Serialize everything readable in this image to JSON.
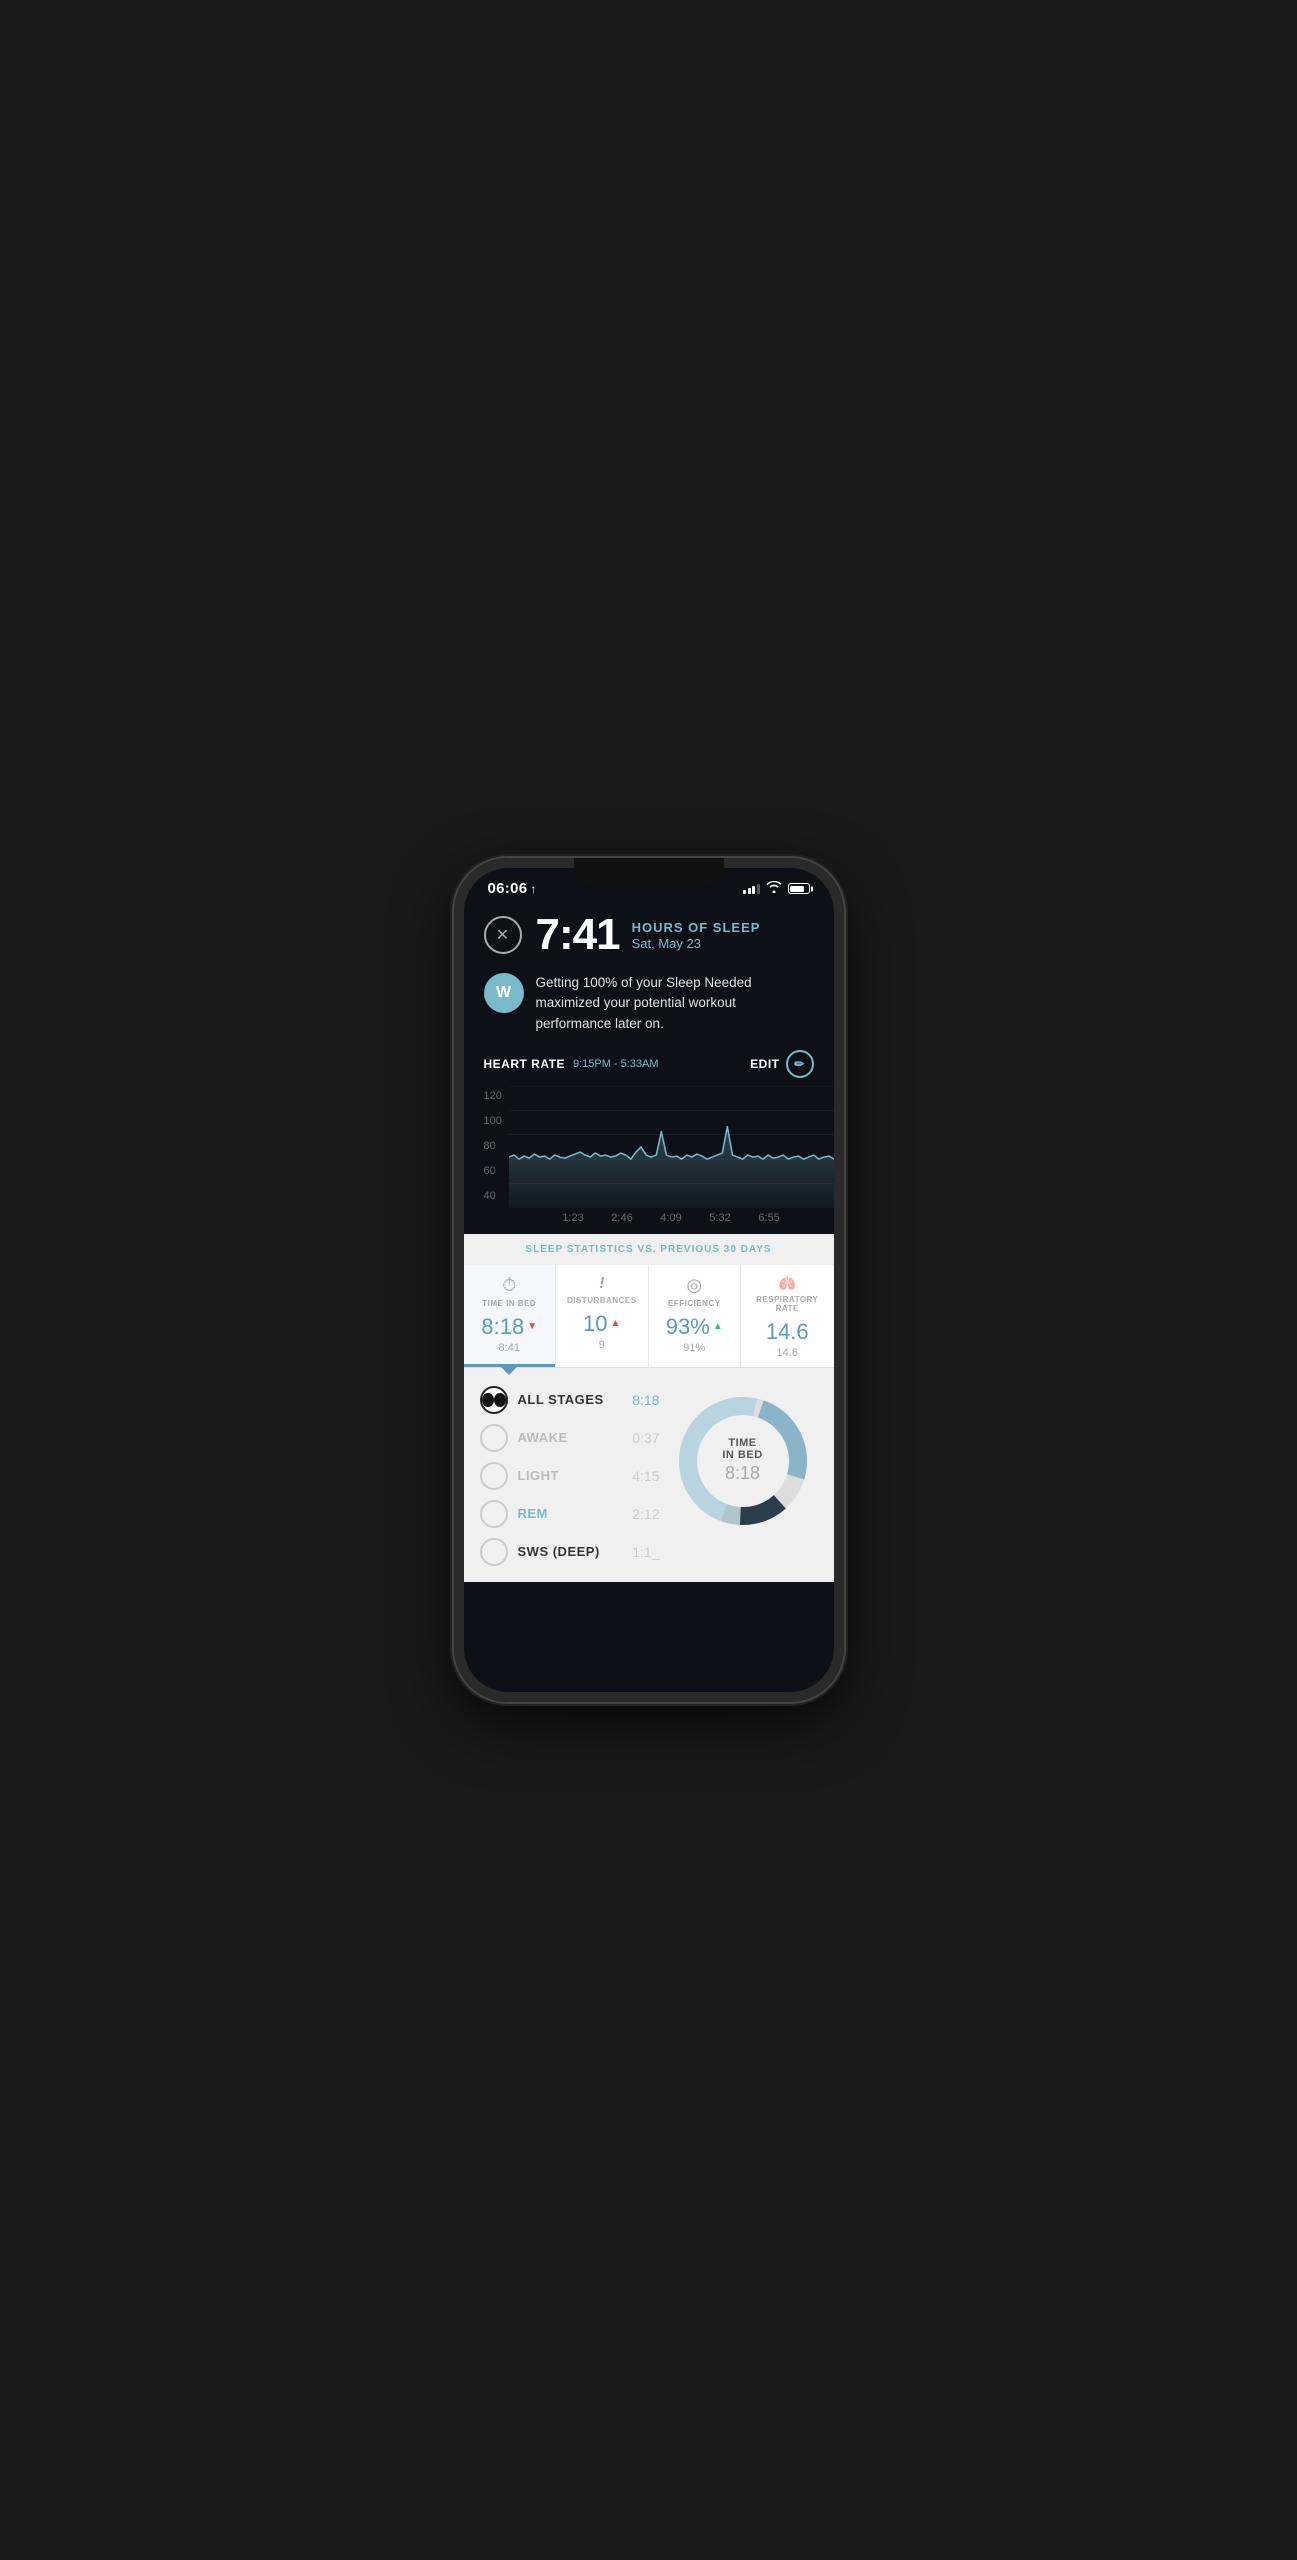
{
  "status": {
    "time": "06:06",
    "location_arrow": "↑"
  },
  "header": {
    "sleep_time": "7:41",
    "label": "HOURS OF SLEEP",
    "date": "Sat, May 23"
  },
  "insight": {
    "avatar_initials": "W",
    "text": "Getting 100% of your Sleep Needed maximized your potential workout performance later on."
  },
  "heart_rate": {
    "title": "HEART RATE",
    "time_range": "9:15PM - 5:33AM",
    "edit_label": "EDIT",
    "y_labels": [
      "120",
      "100",
      "80",
      "60",
      "40"
    ],
    "x_labels": [
      "1:23",
      "2:46",
      "4:09",
      "5:32",
      "6:55"
    ]
  },
  "sleep_stats": {
    "header_label": "SLEEP STATISTICS",
    "vs_label": "VS. PREVIOUS 30 DAYS",
    "tabs": [
      {
        "icon": "⏱",
        "name": "TIME IN BED",
        "value": "8:18",
        "arrow": "▼",
        "arrow_type": "down",
        "prev": "8:41",
        "active": true
      },
      {
        "icon": "!",
        "name": "DISTURBANCES",
        "value": "10",
        "arrow": "▲",
        "arrow_type": "up",
        "prev": "9",
        "active": false
      },
      {
        "icon": "◎",
        "name": "EFFICIENCY",
        "value": "93%",
        "arrow": "▲",
        "arrow_type": "up-green",
        "prev": "91%",
        "active": false
      },
      {
        "icon": "♡",
        "name": "RESPIRATORY RATE",
        "value": "14.6",
        "arrow": "",
        "arrow_type": "none",
        "prev": "14.6",
        "active": false
      }
    ]
  },
  "stages": {
    "donut_center_title": "TIME\nIN BED",
    "donut_center_value": "8:18",
    "items": [
      {
        "name": "ALL STAGES",
        "time": "8:18",
        "selected": true,
        "dim": false
      },
      {
        "name": "AWAKE",
        "time": "0:37",
        "selected": false,
        "dim": true
      },
      {
        "name": "LIGHT",
        "time": "4:15",
        "selected": false,
        "dim": true
      },
      {
        "name": "REM",
        "time": "2:12",
        "selected": false,
        "dim": true
      },
      {
        "name": "SWS (DEEP)",
        "time": "1:1_",
        "selected": false,
        "dim": false
      }
    ]
  }
}
